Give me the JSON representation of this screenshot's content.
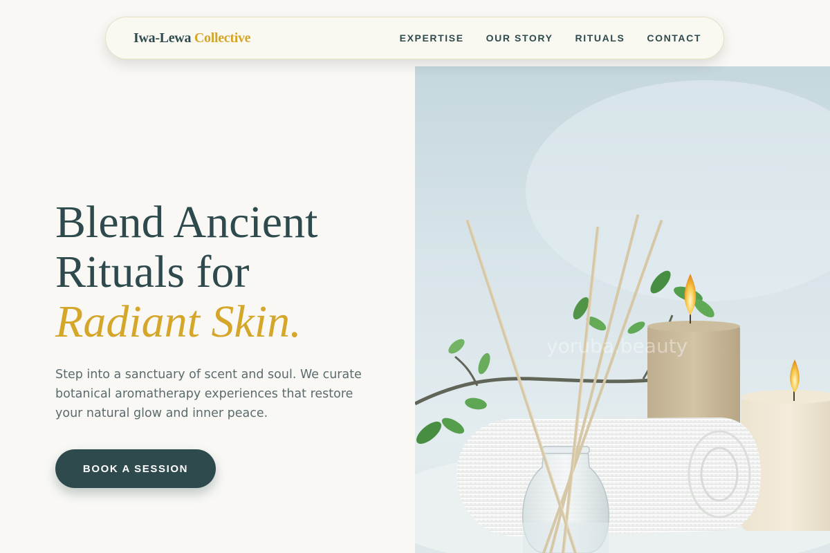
{
  "header": {
    "brand_primary": "Iwa-Lewa",
    "brand_accent": "Collective",
    "nav": [
      {
        "label": "EXPERTISE"
      },
      {
        "label": "OUR STORY"
      },
      {
        "label": "RITUALS"
      },
      {
        "label": "CONTACT"
      }
    ]
  },
  "hero": {
    "title_line1": "Blend Ancient",
    "title_line2": "Rituals for",
    "title_accent": "Radiant Skin.",
    "description": "Step into a sanctuary of scent and soul. We curate botanical aromatherapy experiences that restore your natural glow and inner peace.",
    "cta_label": "BOOK A SESSION",
    "image_watermark": "yoruba.beauty"
  },
  "colors": {
    "primary": "#2e4a4d",
    "accent": "#d4a62a",
    "background": "#f9f8f5"
  }
}
